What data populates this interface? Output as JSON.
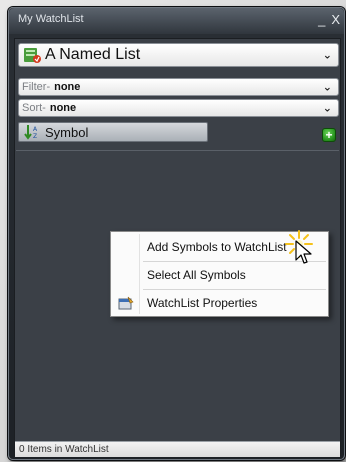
{
  "window": {
    "title": "My WatchList",
    "minimize_glyph": "_",
    "close_glyph": "X"
  },
  "list_selector": {
    "value": "A Named List",
    "icon": "named-list-icon"
  },
  "filter": {
    "label": "Filter-",
    "value": "none"
  },
  "sort": {
    "label": "Sort-",
    "value": "none"
  },
  "column_header": {
    "label": "Symbol",
    "icon": "sort-order-icon"
  },
  "add_button": {
    "glyph": "+"
  },
  "context_menu": {
    "items": [
      {
        "label": "Add Symbols to WatchList"
      },
      {
        "label": "Select All Symbols"
      },
      {
        "label": "WatchList Properties",
        "icon": "properties-icon"
      }
    ]
  },
  "status": {
    "text": "0 Items in WatchList"
  },
  "colors": {
    "panel_bg": "#3b4047",
    "frame_bg": "#1d2126",
    "add_green": "#2c9a23"
  }
}
